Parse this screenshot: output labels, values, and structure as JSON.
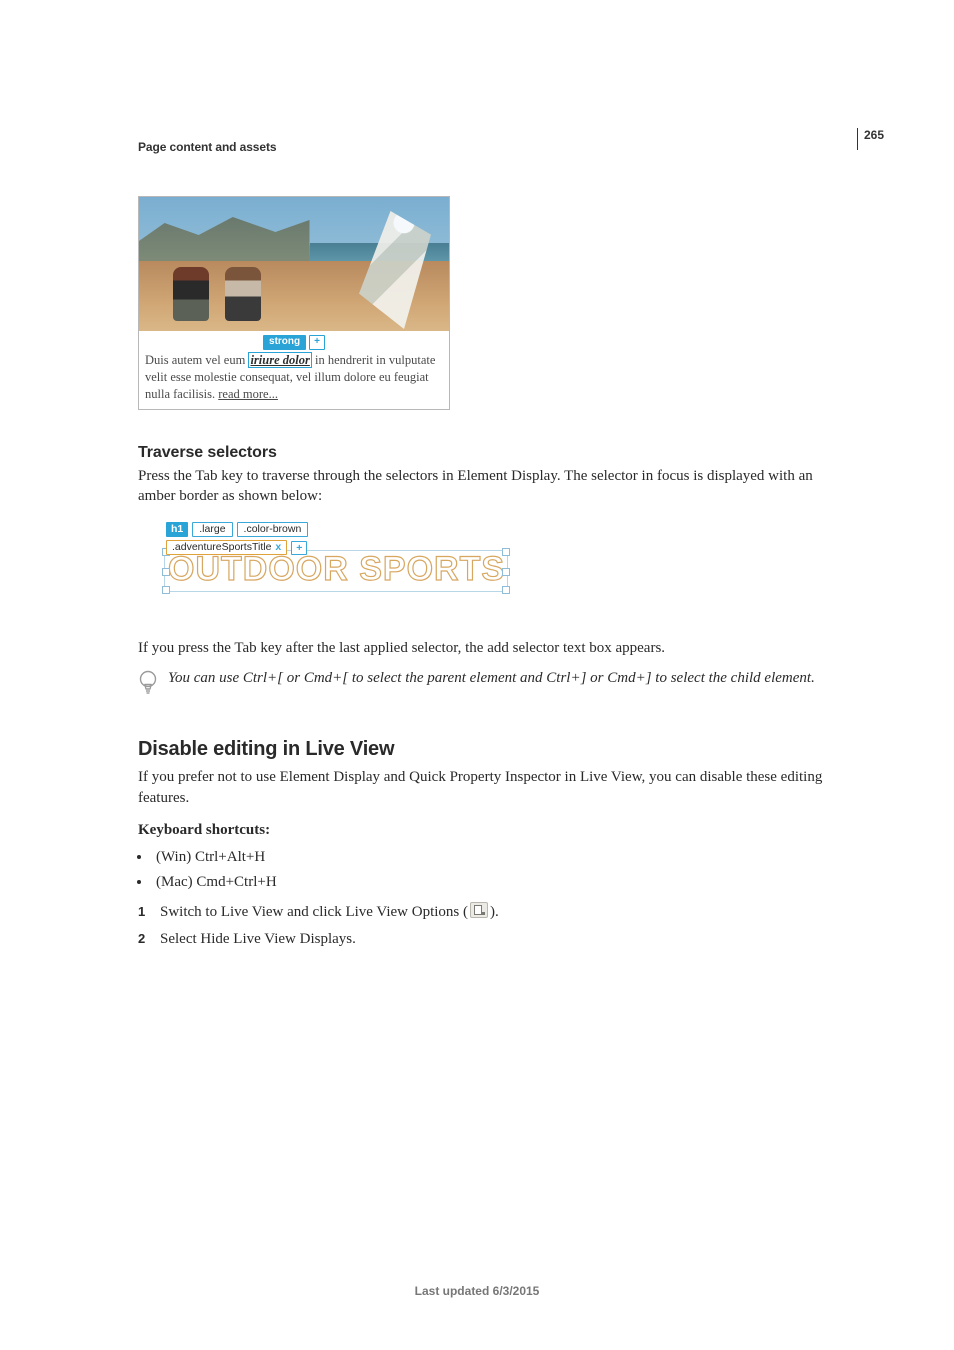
{
  "page_number": "265",
  "section_header": "Page content and assets",
  "fig1": {
    "tag_label": "strong",
    "plus": "+",
    "para_prefix": "Duis autem vel eum ",
    "selected_words": "iriure dolor",
    "para_suffix": " in hendrerit in vulputate velit esse molestie consequat, vel illum dolore eu feugiat nulla facilisis. ",
    "read_more": "read more..."
  },
  "traverse": {
    "heading": "Traverse selectors",
    "para": "Press the Tab key to traverse through the selectors in Element Display. The selector in focus is displayed with an amber border as shown below:"
  },
  "fig2": {
    "tag": "h1",
    "sel1": ".large",
    "sel2": ".color-brown",
    "sel_active": ".adventureSportsTitle",
    "plus": "+",
    "bg_text": "OUTDOOR SPORTS"
  },
  "after_fig2": "If you press the Tab key after the last applied selector, the add selector text box appears.",
  "tip_text": "You can use Ctrl+[ or Cmd+[ to select the parent element and Ctrl+] or Cmd+] to select the child element.",
  "disable": {
    "heading": "Disable editing in Live View",
    "para": "If you prefer not to use Element Display and Quick Property Inspector in Live View, you can disable these editing features.",
    "kb_label": "Keyboard shortcuts:",
    "bullets": [
      "(Win) Ctrl+Alt+H",
      "(Mac) Cmd+Ctrl+H"
    ],
    "steps": [
      {
        "n": "1",
        "pre": "Switch to Live View and click Live View Options (",
        "post": ")."
      },
      {
        "n": "2",
        "text": "Select Hide Live View Displays."
      }
    ]
  },
  "footer": "Last updated 6/3/2015"
}
